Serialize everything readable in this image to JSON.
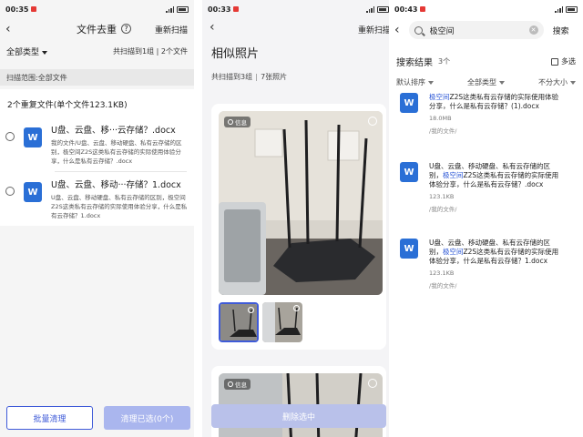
{
  "panel1": {
    "status": {
      "time": "00:35"
    },
    "title": "文件去重",
    "rescan": "重新扫描",
    "filter": "全部类型",
    "scan_count": "共扫描到1组 | 2个文件",
    "scope": "扫描范围:全部文件",
    "dup_header": "2个重复文件(单个文件123.1KB)",
    "files": [
      {
        "name": "U盘、云盘、移···云存储？.docx",
        "desc": "我的文件/U盘、云盘、移动硬盘、私有云存储的区别，极空间Z2S这类私有云存储的实际使用体验分享，什么是私有云存储？.docx"
      },
      {
        "name": "U盘、云盘、移动···存储？1.docx",
        "desc": "U盘、云盘、移动硬盘、私有云存储的区别，极空间Z2S这类私有云存储的实际使用体验分享，什么是私有云存储？1.docx"
      }
    ],
    "batch_clean": "批量清理",
    "clean_selected": "清理已选(0个)"
  },
  "panel2": {
    "status": {
      "time": "00:33"
    },
    "rescan": "重新扫描",
    "title": "相似照片",
    "count_groups": "共扫描到3组",
    "count_photos": "7张照片",
    "info_label": "信息",
    "delete": "删除选中"
  },
  "panel3": {
    "status": {
      "time": "00:43"
    },
    "query": "极空间",
    "search_btn": "搜索",
    "results_title": "搜索结果",
    "results_count": "3个",
    "multi_select": "多选",
    "sort_default": "默认排序",
    "sort_type": "全部类型",
    "sort_size": "不分大小",
    "results": [
      {
        "pre": "",
        "hl": "极空间",
        "post": "Z2S这类私有云存储的实际使用体验分享，什么是私有云存储？(1).docx",
        "size": "18.0MB",
        "path": "/我的文件/"
      },
      {
        "pre": "U盘、云盘、移动硬盘、私有云存储的区别，",
        "hl": "极空间",
        "post": "Z2S这类私有云存储的实际使用体验分享，什么是私有云存储？.docx",
        "size": "123.1KB",
        "path": "/我的文件/"
      },
      {
        "pre": "U盘、云盘、移动硬盘、私有云存储的区别，",
        "hl": "极空间",
        "post": "Z2S这类私有云存储的实际使用体验分享，什么是私有云存储？1.docx",
        "size": "123.1KB",
        "path": "/我的文件/"
      }
    ]
  },
  "colors": {
    "accent": "#3f5bd8",
    "word_blue": "#2a6fd6",
    "highlight": "#2a56d6"
  },
  "icons": {
    "word": "W"
  }
}
